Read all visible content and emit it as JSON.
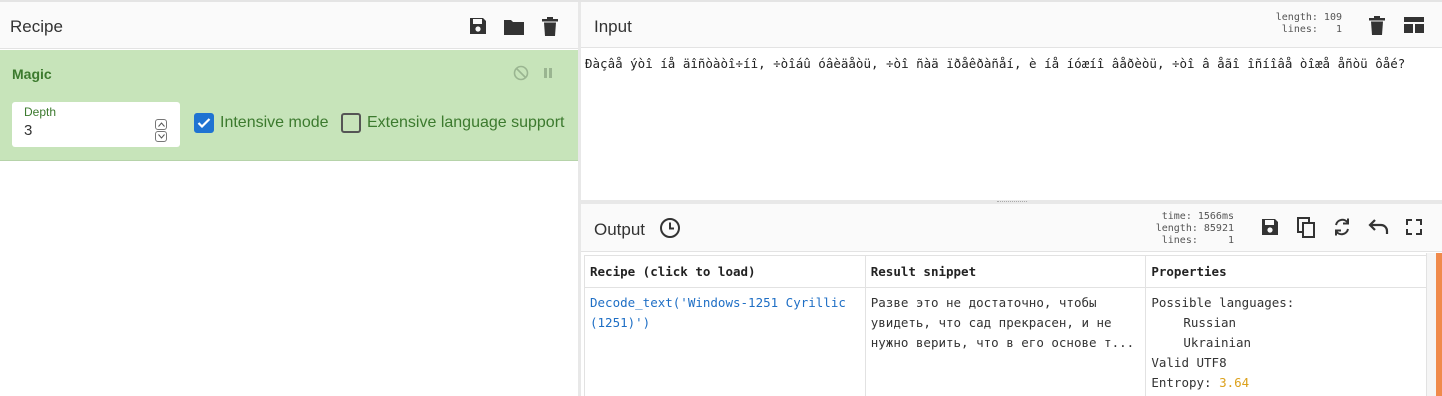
{
  "recipe": {
    "title": "Recipe",
    "icons": [
      "save-icon",
      "folder-icon",
      "trash-icon"
    ],
    "operation": {
      "name": "Magic",
      "depth_label": "Depth",
      "depth_value": "3",
      "intensive_label": "Intensive mode",
      "intensive_checked": true,
      "extensive_label": "Extensive language support",
      "extensive_checked": false
    }
  },
  "input": {
    "title": "Input",
    "stats": "length: 109\n lines:   1",
    "text": "Ðàçâå ýòî íå äîñòàòî÷íî, ÷òîáû óâèäåòü, ÷òî ñàä ïðåêðàñåí, è íå íóæíî âåðèòü, ÷òî â åãî îñíîâå òîæå åñòü ôåé?"
  },
  "output": {
    "title": "Output",
    "stats": "time: 1566ms\nlength: 85921\n lines:     1",
    "columns": [
      "Recipe (click to load)",
      "Result snippet",
      "Properties"
    ],
    "row": {
      "recipe": "Decode_text('Windows-1251 Cyrillic (1251)')",
      "snippet": "Разве это не достаточно, чтобы увидеть, что сад прекрасен, и не нужно верить, что в его основе т...",
      "prop_languages_label": "Possible languages:",
      "lang1": "Russian",
      "lang2": "Ukrainian",
      "valid": "Valid UTF8",
      "entropy_label": "Entropy: ",
      "entropy_value": "3.64"
    }
  },
  "colors": {
    "accent": "#1f73d2",
    "op_bg": "#c7e4ba",
    "op_text": "#3c7a2e",
    "entropy": "#dca11b",
    "scroll": "#f08a4b"
  }
}
